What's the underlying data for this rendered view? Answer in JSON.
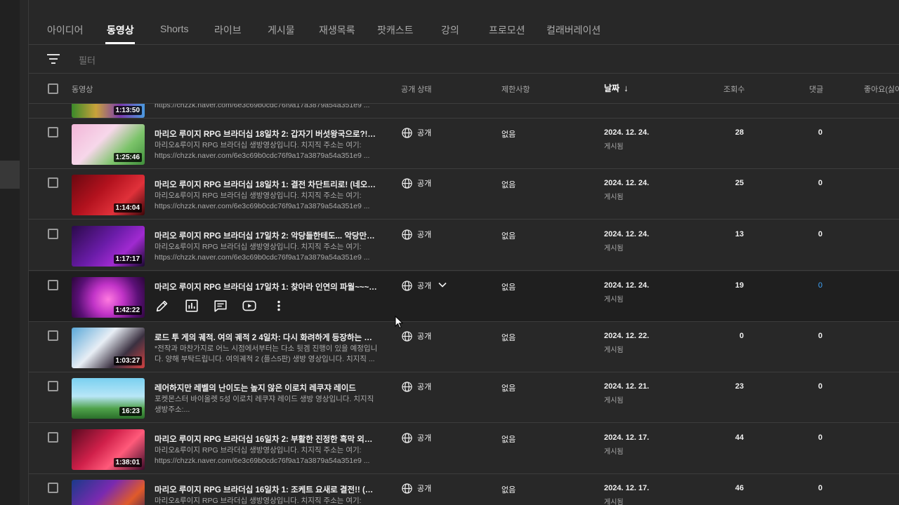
{
  "tabs": [
    {
      "label": "아이디어",
      "active": false
    },
    {
      "label": "동영상",
      "active": true
    },
    {
      "label": "Shorts",
      "active": false
    },
    {
      "label": "라이브",
      "active": false
    },
    {
      "label": "게시물",
      "active": false
    },
    {
      "label": "재생목록",
      "active": false
    },
    {
      "label": "팟캐스트",
      "active": false
    },
    {
      "label": "강의",
      "active": false
    },
    {
      "label": "프로모션",
      "active": false
    },
    {
      "label": "컬래버레이션",
      "active": false
    }
  ],
  "filter": {
    "placeholder": "필터",
    "icon": "filter-icon"
  },
  "columns": {
    "video": "동영상",
    "visibility": "공개 상태",
    "restrictions": "제한사항",
    "date": "날짜",
    "views": "조회수",
    "comments": "댓글",
    "likes": "좋아요(싫어"
  },
  "partial_row": {
    "duration": "1:13:50",
    "desc": "https://chzzk.naver.com/6e3c69b0cdc76f9a17a3879a54a351e9 ..."
  },
  "rows": [
    {
      "duration": "1:25:46",
      "title": "마리오 루이지 RPG 브라더십 18일차 2: 갑자기 버섯왕국으로?! (마...",
      "desc": "마리오&루이지 RPG 브라더십 생방영상입니다. 치지직 주소는 여기: https://chzzk.naver.com/6e3c69b0cdc76f9a17a3879a54a351e9 ...",
      "visibility": "공개",
      "restriction": "없음",
      "date": "2024. 12. 24.",
      "status": "게시됨",
      "views": "28",
      "comments": "0"
    },
    {
      "duration": "1:14:04",
      "title": "마리오 루이지 RPG 브라더십 18일차 1: 결전 차단트리로! (네오 조...",
      "desc": "마리오&루이지 RPG 브라더십 생방영상입니다. 치지직 주소는 여기: https://chzzk.naver.com/6e3c69b0cdc76f9a17a3879a54a351e9 ...",
      "visibility": "공개",
      "restriction": "없음",
      "date": "2024. 12. 24.",
      "status": "게시됨",
      "views": "25",
      "comments": "0"
    },
    {
      "duration": "1:17:17",
      "title": "마리오 루이지 RPG 브라더십 17일차 2: 악당들한테도... 악당만의 ...",
      "desc": "마리오&루이지 RPG 브라더십 생방영상입니다. 치지직 주소는 여기: https://chzzk.naver.com/6e3c69b0cdc76f9a17a3879a54a351e9 ...",
      "visibility": "공개",
      "restriction": "없음",
      "date": "2024. 12. 24.",
      "status": "게시됨",
      "views": "13",
      "comments": "0"
    },
    {
      "duration": "1:42:22",
      "title": "마리오 루이지 RPG 브라더십 17일차 1: 찾아라 인연의 파월~~~ 0...",
      "desc": "",
      "visibility": "공개",
      "restriction": "없음",
      "date": "2024. 12. 24.",
      "status": "게시됨",
      "views": "19",
      "comments": "0"
    },
    {
      "duration": "1:03:27",
      "title": "로드 투 게의 궤적. 여의 궤적 2 4일차: 다시 화려하게 등장하는 전투...",
      "desc": "*전작과 마찬가지로 어느 시점에서부터는 다소 뒷겜 진행이 있을 예정입니다. 양해 부탁드립니다. 여의궤적 2 (플스5판) 생방 영상입니다. 치지직 ...",
      "visibility": "공개",
      "restriction": "없음",
      "date": "2024. 12. 22.",
      "status": "게시됨",
      "views": "0",
      "comments": "0"
    },
    {
      "duration": "16:23",
      "title": "레어하지만 레벨의 난이도는 높지 않은 이로치 레쿠쟈 레이드",
      "desc": "포켓몬스터 바이올렛 5성 이로치 레쿠쟈 레이드 생방 영상입니다. 치지직 생방주소:...",
      "visibility": "공개",
      "restriction": "없음",
      "date": "2024. 12. 21.",
      "status": "게시됨",
      "views": "23",
      "comments": "0"
    },
    {
      "duration": "1:38:01",
      "title": "마리오 루이지 RPG 브라더십 16일차 2: 부활한 진정한 흑막 외토리...",
      "desc": "마리오&루이지 RPG 브라더십 생방영상입니다. 치지직 주소는 여기: https://chzzk.naver.com/6e3c69b0cdc76f9a17a3879a54a351e9 ...",
      "visibility": "공개",
      "restriction": "없음",
      "date": "2024. 12. 17.",
      "status": "게시됨",
      "views": "44",
      "comments": "0"
    },
    {
      "duration": "",
      "title": "마리오 루이지 RPG 브라더십 16일차 1: 조케트 요새로 결전!! (아니 ...",
      "desc": "마리오&루이지 RPG 브라더십 생방영상입니다. 치지직 주소는 여기:",
      "visibility": "공개",
      "restriction": "없음",
      "date": "2024. 12. 17.",
      "status": "게시됨",
      "views": "46",
      "comments": "0"
    }
  ],
  "hover_actions": [
    "edit-pencil-icon",
    "analytics-icon",
    "comments-icon",
    "youtube-play-icon",
    "more-vert-icon"
  ],
  "colors": {
    "background": "#282828",
    "border": "#3d3d3d",
    "link": "#3ea6ff",
    "hover_row": "#1f1f1f"
  }
}
